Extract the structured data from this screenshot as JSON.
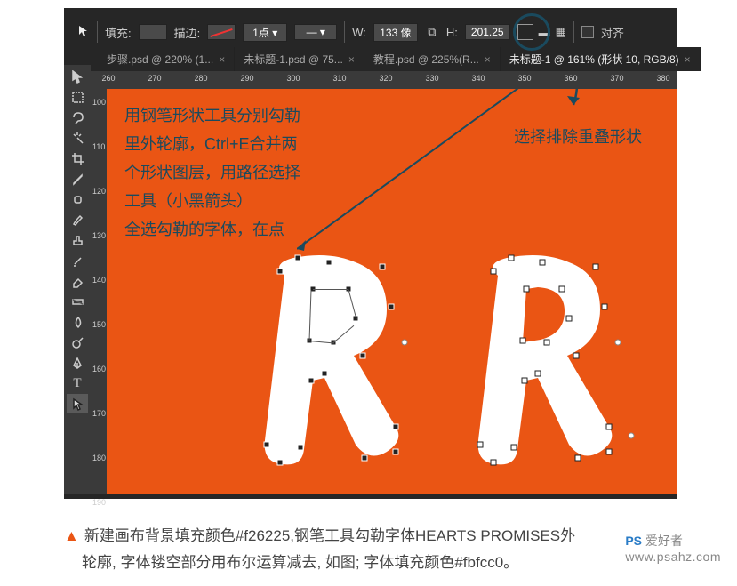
{
  "options": {
    "fill_label": "填充:",
    "stroke_label": "描边:",
    "stroke_val": "1点",
    "w_label": "W:",
    "w_val": "133 像",
    "h_label": "H:",
    "h_val": "201.25",
    "align_label": "对齐"
  },
  "tabs": [
    {
      "label": "步骤.psd @ 220% (1...",
      "active": false
    },
    {
      "label": "未标题-1.psd @ 75...",
      "active": false
    },
    {
      "label": "教程.psd @ 225%(R...",
      "active": false
    },
    {
      "label": "未标题-1 @ 161% (形状 10, RGB/8)",
      "active": true
    }
  ],
  "ruler_h": [
    "260",
    "270",
    "280",
    "290",
    "300",
    "310",
    "320",
    "330",
    "340",
    "350",
    "360",
    "370",
    "380"
  ],
  "ruler_v": [
    "100",
    "110",
    "120",
    "130",
    "140",
    "150",
    "160",
    "170",
    "180",
    "190"
  ],
  "note1_lines": [
    "用钢笔形状工具分别勾勒",
    "里外轮廓，Ctrl+E合并两",
    "个形状图层，用路径选择",
    "工具（小黑箭头）",
    "全选勾勒的字体，在点"
  ],
  "note2": "选择排除重叠形状",
  "caption": {
    "line1": "新建画布背景填充颜色#f26225,钢笔工具勾勒字体HEARTS PROMISES外",
    "line2": "轮廓, 字体镂空部分用布尔运算减去, 如图; 字体填充颜色#fbfcc0。"
  },
  "watermark": {
    "ps": "PS",
    "txt": "爱好者",
    "url": "www.psahz.com"
  }
}
